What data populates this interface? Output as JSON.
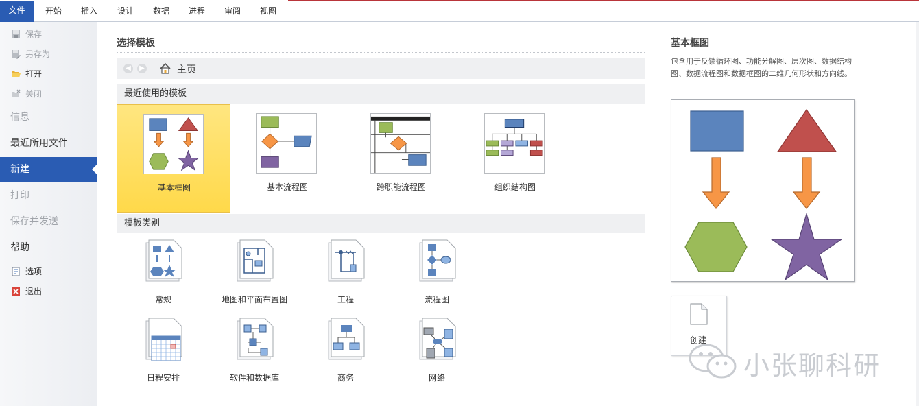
{
  "ribbon": {
    "tabs": [
      "文件",
      "开始",
      "插入",
      "设计",
      "数据",
      "进程",
      "审阅",
      "视图"
    ]
  },
  "nav": {
    "save": "保存",
    "save_as": "另存为",
    "open": "打开",
    "close": "关闭",
    "info": "信息",
    "recent": "最近所用文件",
    "new": "新建",
    "print": "打印",
    "save_send": "保存并发送",
    "help": "帮助",
    "options": "选项",
    "exit": "退出"
  },
  "main": {
    "title": "选择模板",
    "home_label": "主页",
    "recent_header": "最近使用的模板",
    "category_header": "模板类别",
    "recent_templates": [
      {
        "label": "基本框图",
        "selected": true
      },
      {
        "label": "基本流程图",
        "selected": false
      },
      {
        "label": "跨职能流程图",
        "selected": false
      },
      {
        "label": "组织结构图",
        "selected": false
      }
    ],
    "categories": [
      "常规",
      "地图和平面布置图",
      "工程",
      "流程图",
      "日程安排",
      "软件和数据库",
      "商务",
      "网络"
    ]
  },
  "preview": {
    "title": "基本框图",
    "description": "包含用于反馈循环图、功能分解图、层次图、数据结构图、数据流程图和数据框图的二维几何形状和方向线。",
    "create_label": "创建"
  },
  "watermark": {
    "text": "小张聊科研"
  },
  "colors": {
    "accent_blue": "#2a5cb3",
    "selected_tile": "#ffd94a",
    "shape_blue": "#5b84bd",
    "shape_red": "#c0504d",
    "shape_orange": "#f79646",
    "shape_green": "#9bbb59",
    "shape_purple": "#8064a2"
  }
}
